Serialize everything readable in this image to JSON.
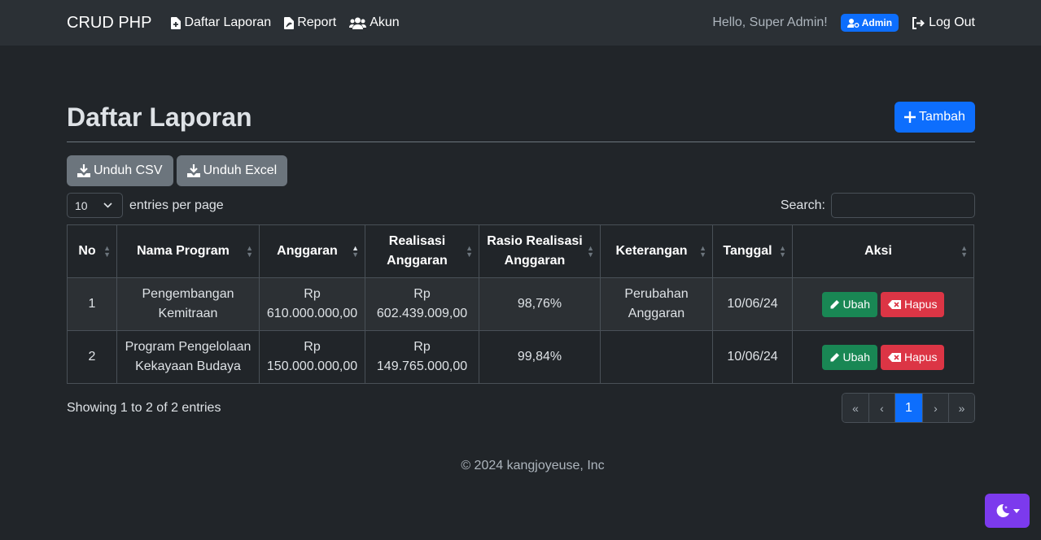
{
  "navbar": {
    "brand": "CRUD PHP",
    "links": [
      "Daftar Laporan",
      "Report",
      "Akun"
    ],
    "greeting": "Hello, Super Admin!",
    "role_badge": "Admin",
    "logout": "Log Out"
  },
  "page": {
    "title": "Daftar Laporan",
    "add_button": "Tambah",
    "export": [
      "Unduh CSV",
      "Unduh Excel"
    ],
    "per_page_value": "10",
    "per_page_label": "entries per page",
    "search_label": "Search:",
    "search_value": ""
  },
  "table": {
    "headers": [
      "No",
      "Nama Program",
      "Anggaran",
      "Realisasi Anggaran",
      "Rasio Realisasi Anggaran",
      "Keterangan",
      "Tanggal",
      "Aksi"
    ],
    "rows": [
      {
        "no": "1",
        "program": "Pengembangan Kemitraan",
        "anggaran": "Rp 610.000.000,00",
        "realisasi": "Rp 602.439.009,00",
        "rasio": "98,76%",
        "keterangan": "Perubahan Anggaran",
        "tanggal": "10/06/24"
      },
      {
        "no": "2",
        "program": "Program Pengelolaan Kekayaan Budaya",
        "anggaran": "Rp 150.000.000,00",
        "realisasi": "Rp 149.765.000,00",
        "rasio": "99,84%",
        "keterangan": "",
        "tanggal": "10/06/24"
      }
    ],
    "edit_label": "Ubah",
    "delete_label": "Hapus"
  },
  "info": "Showing 1 to 2 of 2 entries",
  "pagination": {
    "first": "«",
    "prev": "‹",
    "current": "1",
    "next": "›",
    "last": "»"
  },
  "footer": "© 2024 kangjoyeuse, Inc",
  "colors": {
    "primary": "#0d6efd",
    "secondary": "#6c757d",
    "success": "#198754",
    "danger": "#dc3545",
    "theme_toggle": "#7c3aed"
  },
  "icons": {
    "add_report": "file-plus-icon",
    "report": "file-pdf-icon",
    "accounts": "users-icon",
    "admin": "user-gear-icon",
    "logout": "logout-icon",
    "add": "plus-icon",
    "download": "download-icon",
    "edit": "pencil-icon",
    "delete": "delete-x-icon",
    "theme": "moon-icon"
  }
}
